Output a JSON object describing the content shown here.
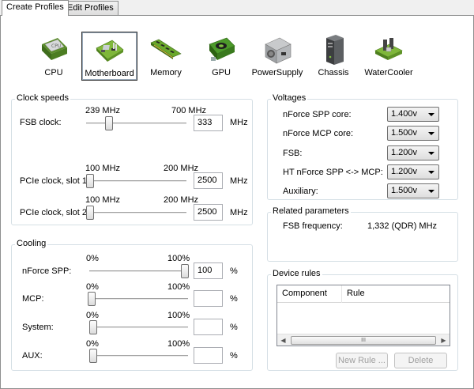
{
  "tabs": [
    {
      "label": "Create Profiles",
      "active": true
    },
    {
      "label": "Edit Profiles",
      "active": false
    }
  ],
  "toolbar": {
    "items": [
      {
        "label": "CPU",
        "icon": "cpu-chip-icon",
        "chip_text": "CPU"
      },
      {
        "label": "Motherboard",
        "icon": "motherboard-icon",
        "selected": true
      },
      {
        "label": "Memory",
        "icon": "memory-module-icon"
      },
      {
        "label": "GPU",
        "icon": "graphics-card-icon"
      },
      {
        "label": "PowerSupply",
        "icon": "power-supply-icon"
      },
      {
        "label": "Chassis",
        "icon": "chassis-tower-icon"
      },
      {
        "label": "WaterCooler",
        "icon": "water-cooler-icon"
      }
    ]
  },
  "clock_speeds": {
    "title": "Clock speeds",
    "fsb": {
      "label": "FSB clock:",
      "min_label": "239 MHz",
      "max_label": "700 MHz",
      "value": "333",
      "unit": "MHz",
      "slider_fraction": 0.205
    },
    "pcie1": {
      "label": "PCIe clock, slot 1:",
      "min_label": "100 MHz",
      "max_label": "200 MHz",
      "value": "2500",
      "unit": "MHz",
      "slider_fraction": 0.0
    },
    "pcie2": {
      "label": "PCIe clock, slot 2:",
      "min_label": "100 MHz",
      "max_label": "200 MHz",
      "value": "2500",
      "unit": "MHz",
      "slider_fraction": 0.0
    }
  },
  "voltages": {
    "title": "Voltages",
    "rows": [
      {
        "label": "nForce SPP core:",
        "value": "1.400v"
      },
      {
        "label": "nForce MCP core:",
        "value": "1.500v"
      },
      {
        "label": "FSB:",
        "value": "1.200v"
      },
      {
        "label": "HT nForce SPP <-> MCP:",
        "value": "1.200v"
      },
      {
        "label": "Auxiliary:",
        "value": "1.500v"
      }
    ]
  },
  "related": {
    "title": "Related parameters",
    "label": "FSB frequency:",
    "value": "1,332 (QDR) MHz"
  },
  "cooling": {
    "title": "Cooling",
    "rows": [
      {
        "label": "nForce SPP:",
        "min_label": "0%",
        "max_label": "100%",
        "value": "100",
        "unit": "%",
        "slider_fraction": 1.0
      },
      {
        "label": "MCP:",
        "min_label": "0%",
        "max_label": "100%",
        "value": "",
        "unit": "%",
        "slider_fraction": 0.0
      },
      {
        "label": "System:",
        "min_label": "0%",
        "max_label": "100%",
        "value": "",
        "unit": "%",
        "slider_fraction": 0.0
      },
      {
        "label": "AUX:",
        "min_label": "0%",
        "max_label": "100%",
        "value": "",
        "unit": "%",
        "slider_fraction": 0.0
      }
    ]
  },
  "device_rules": {
    "title": "Device rules",
    "columns": [
      "Component",
      "Rule"
    ],
    "scroll_grip": "III",
    "new_rule_label": "New Rule ...",
    "delete_label": "Delete"
  },
  "colors": {
    "groupbox_border": "#d5dfe5",
    "disabled_text": "#a0a0a0",
    "selection_border": "#333333"
  }
}
